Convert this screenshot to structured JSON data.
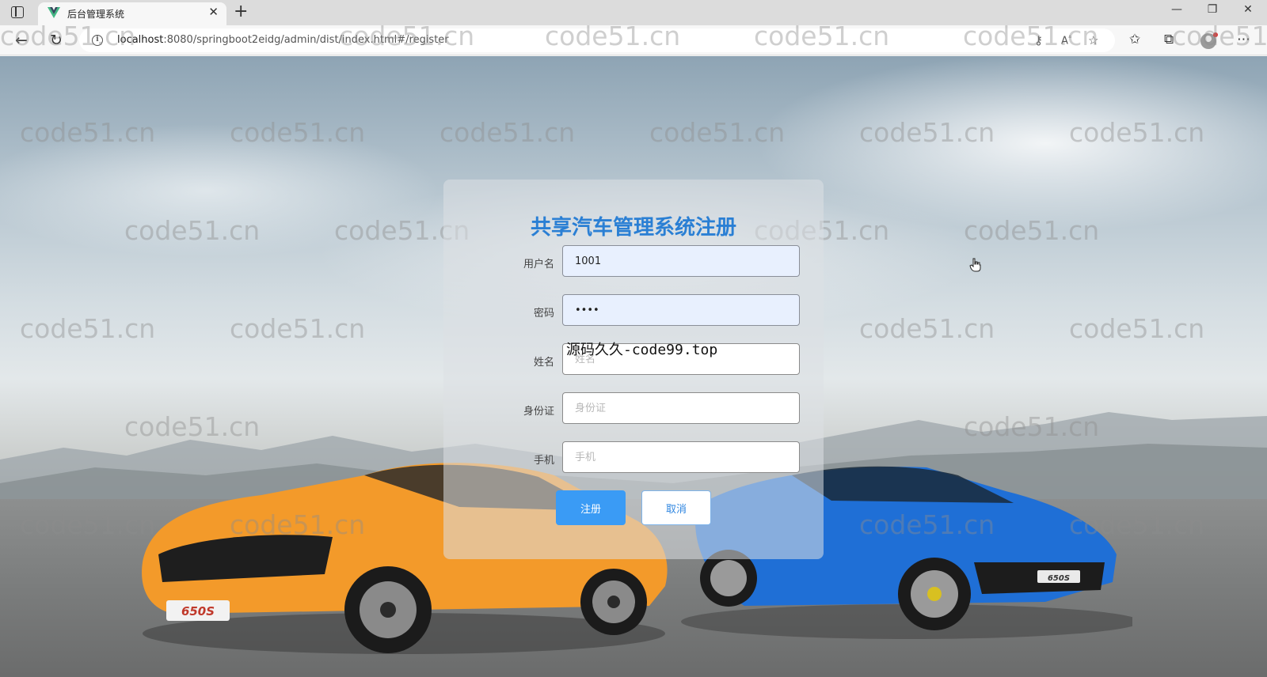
{
  "browser": {
    "tab_title": "后台管理系统",
    "url_host": "localhost",
    "url_rest": ":8080/springboot2eidg/admin/dist/index.html#/register",
    "icons": [
      "sidebar-toggle-icon",
      "vue-favicon-icon",
      "close-icon",
      "plus-icon",
      "minimize-icon",
      "restore-icon",
      "window-close-icon",
      "back-arrow-icon",
      "refresh-icon",
      "info-icon",
      "key-icon",
      "read-aloud-icon",
      "favorite-add-icon",
      "favorites-icon",
      "collections-icon",
      "profile-icon",
      "more-icon"
    ]
  },
  "register": {
    "title": "共享汽车管理系统注册",
    "fields": [
      {
        "label": "用户名",
        "value": "1001",
        "placeholder": ""
      },
      {
        "label": "密码",
        "value": "1234",
        "placeholder": ""
      },
      {
        "label": "姓名",
        "value": "",
        "placeholder": "姓名"
      },
      {
        "label": "身份证",
        "value": "",
        "placeholder": "身份证"
      },
      {
        "label": "手机",
        "value": "",
        "placeholder": "手机"
      }
    ],
    "submit_label": "注册",
    "cancel_label": "取消"
  },
  "overlay_text": "源码久久-code99.top",
  "watermark_text": "code51.cn",
  "colors": {
    "title": "#2a7fd4",
    "primary_button": "#3a9bf5",
    "orange_car": "#f39a2a",
    "blue_car": "#1f6fd6"
  }
}
